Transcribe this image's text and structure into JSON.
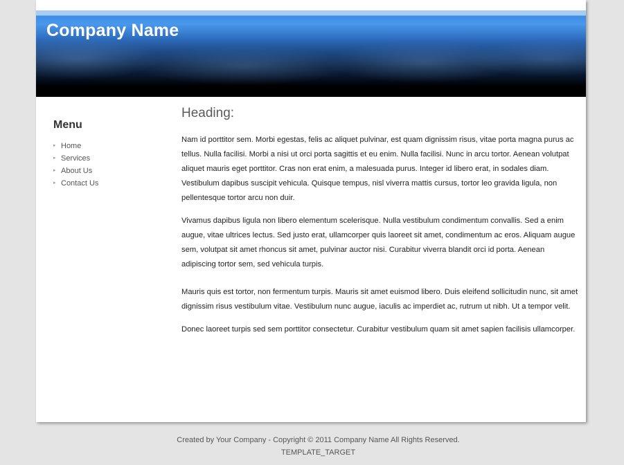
{
  "header": {
    "company_name": "Company Name"
  },
  "sidebar": {
    "title": "Menu",
    "items": [
      {
        "label": "Home"
      },
      {
        "label": "Services"
      },
      {
        "label": "About Us"
      },
      {
        "label": "Contact Us"
      }
    ]
  },
  "main": {
    "heading": "Heading:",
    "paragraphs": [
      "Nam id porttitor sem. Morbi egestas, felis ac aliquet pulvinar, est quam dignissim risus, vitae porta magna purus ac tellus. Nulla facilisi. Morbi a nisi ut orci porta sagittis et eu enim. Nulla facilisi. Nunc in arcu tortor. Aenean volutpat aliquet mauris eget porttitor. Cras non erat enim, a malesuada purus. Integer id libero erat, in sodales diam. Vestibulum dapibus suscipit vehicula. Quisque tempus, nisl viverra mattis cursus, tortor leo gravida ligula, non pellentesque tortor arcu non duir.",
      "Vivamus dapibus ligula non libero elementum scelerisque. Nulla vestibulum condimentum convallis. Sed a enim augue, vitae ultrices lectus. Sed justo erat, ullamcorper quis laoreet sit amet, condimentum ac eros. Aliquam augue sem, volutpat sit amet rhoncus sit amet, pulvinar auctor nisi. Curabitur viverra blandit orci id porta. Aenean adipiscing tortor sem, sed vehicula turpis.",
      "Mauris quis est tortor, non fermentum turpis. Mauris sit amet euismod libero. Duis eleifend sollicitudin nunc, sit amet dignissim risus vestibulum vitae. Vestibulum nunc augue, iaculis ac imperdiet ac, rutrum ut nibh. Ut a tempor velit.",
      "Donec laoreet turpis sed sem porttitor consectetur. Curabitur vestibulum quam sit amet sapien facilisis ullamcorper."
    ]
  },
  "footer": {
    "copyright": "Created by Your Company - Copyright © 2011 Company Name All Rights Reserved.",
    "template_target": "TEMPLATE_TARGET"
  },
  "icons": {
    "menu_bullet": "bullet-icon"
  }
}
